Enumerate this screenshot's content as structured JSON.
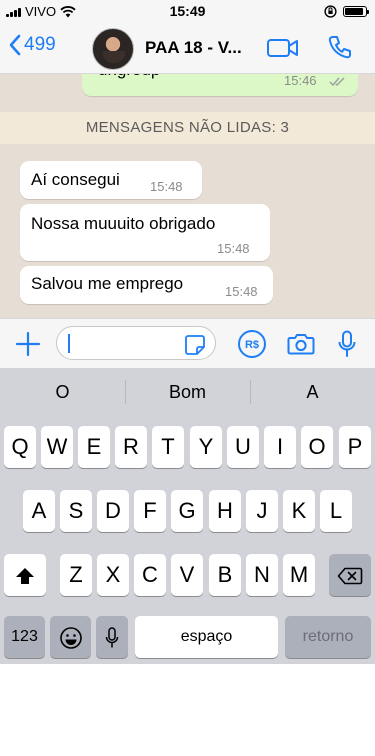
{
  "status_bar": {
    "carrier": "VIVO",
    "time": "15:49",
    "battery_level": 0.92
  },
  "header": {
    "back_count": "499",
    "chat_title": "PAA 18 - V..."
  },
  "chat": {
    "partial_out_text": "ungroup",
    "partial_out_time": "15:46",
    "unread_divider": "MENSAGENS NÃO LIDAS: 3",
    "messages": [
      {
        "text": "Aí consegui",
        "time": "15:48"
      },
      {
        "text": "Nossa muuuito obrigado",
        "time": "15:48"
      },
      {
        "text": "Salvou me emprego",
        "time": "15:48"
      }
    ]
  },
  "input": {
    "value": "",
    "currency_label": "R$"
  },
  "keyboard": {
    "suggestions": [
      "O",
      "Bom",
      "A"
    ],
    "row1": [
      "Q",
      "W",
      "E",
      "R",
      "T",
      "Y",
      "U",
      "I",
      "O",
      "P"
    ],
    "row2": [
      "A",
      "S",
      "D",
      "F",
      "G",
      "H",
      "J",
      "K",
      "L"
    ],
    "row3": [
      "Z",
      "X",
      "C",
      "V",
      "B",
      "N",
      "M"
    ],
    "numbers_key": "123",
    "space_key": "espaço",
    "return_key": "retorno"
  },
  "colors": {
    "accent": "#1f7ef6",
    "outgoing_bubble": "#dcf8c6",
    "chat_bg": "#e6ded5",
    "unread_bg": "#f2e9d8"
  },
  "icons": [
    "signal-icon",
    "wifi-icon",
    "orientation-lock-icon",
    "battery-icon",
    "chevron-left-icon",
    "video-call-icon",
    "phone-icon",
    "plus-icon",
    "sticker-icon",
    "payment-icon",
    "camera-icon",
    "microphone-icon",
    "double-check-icon",
    "shift-icon",
    "backspace-icon",
    "emoji-icon",
    "dictation-icon"
  ]
}
